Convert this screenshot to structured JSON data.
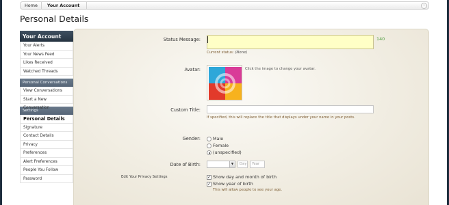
{
  "breadcrumb": {
    "home": "Home",
    "current": "Your Account",
    "jump_icon": "chevron-right-icon"
  },
  "page_title": "Personal Details",
  "sidebar": {
    "header": "Your Account",
    "groups": [
      {
        "title": null,
        "items": [
          "Your Alerts",
          "Your News Feed",
          "Likes Received",
          "Watched Threads"
        ]
      },
      {
        "title": "Personal Conversations",
        "items": [
          "View Conversations",
          "Start a New Conversation"
        ]
      },
      {
        "title": "Settings",
        "items": [
          "Personal Details",
          "Signature",
          "Contact Details",
          "Privacy",
          "Preferences",
          "Alert Preferences",
          "People You Follow",
          "Password"
        ]
      }
    ],
    "active": "Personal Details"
  },
  "form": {
    "status": {
      "label": "Status Message:",
      "value": "",
      "counter": "140",
      "current_prefix": "Current status:",
      "current_value": "(None)"
    },
    "avatar": {
      "label": "Avatar:",
      "hint": "Click the image to change your avatar.",
      "colors": [
        "#2ea7d9",
        "#d93c98",
        "#e23a2a",
        "#f7b21e"
      ]
    },
    "custom_title": {
      "label": "Custom Title:",
      "value": "",
      "hint": "If specified, this will replace the title that displays under your name in your posts."
    },
    "gender": {
      "label": "Gender:",
      "options": [
        "Male",
        "Female",
        "(unspecified)"
      ],
      "selected": "(unspecified)"
    },
    "dob": {
      "label": "Date of Birth:",
      "month_value": "",
      "day_placeholder": "Day",
      "year_placeholder": "Year"
    },
    "privacy": {
      "label": "Edit Your Privacy Settings",
      "show_day_month": "Show day and month of birth",
      "show_year": "Show year of birth",
      "year_hint": "This will allow people to see your age.",
      "show_day_month_checked": true,
      "show_year_checked": true
    }
  }
}
